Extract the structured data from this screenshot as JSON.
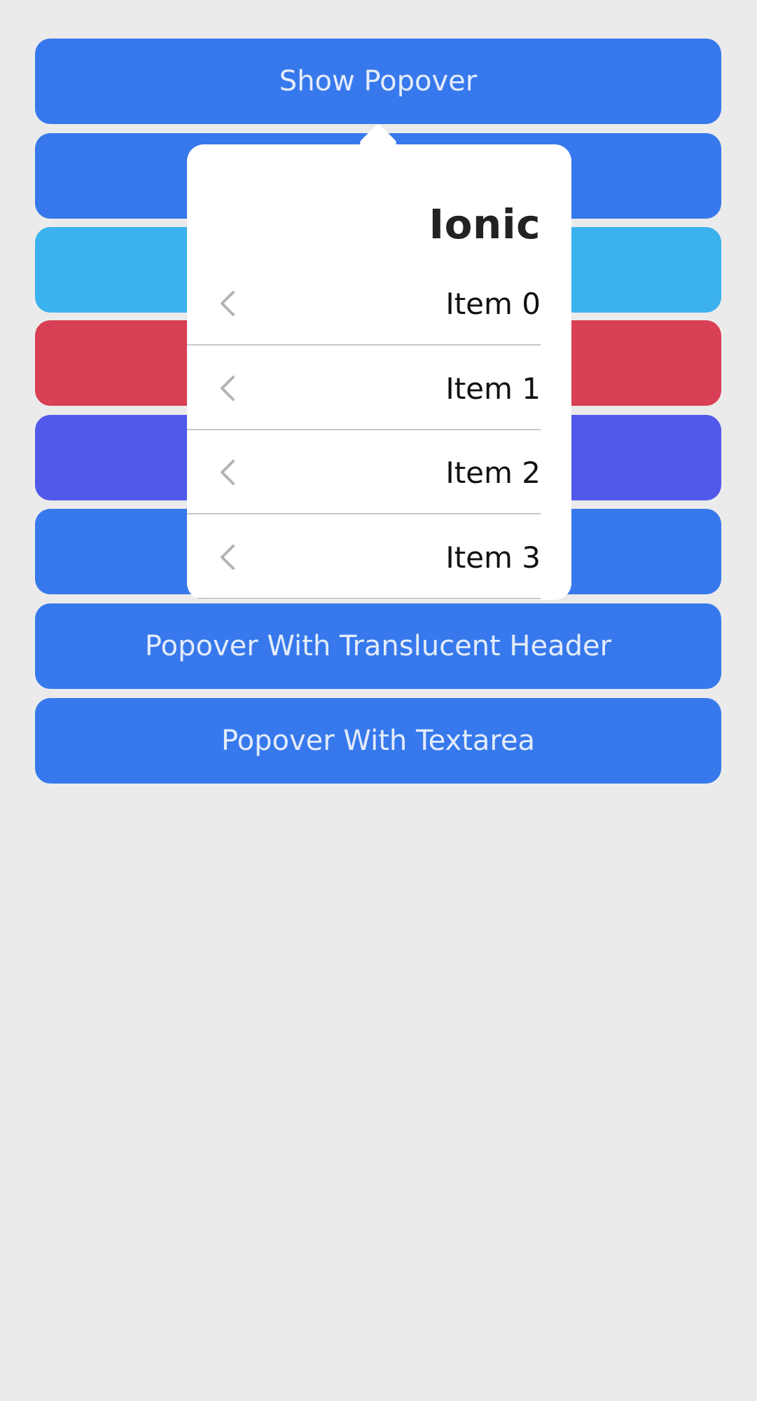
{
  "colors": {
    "background": "#ebebeb",
    "primary": "#3779ec",
    "secondary": "#3bb2ee",
    "danger": "#d93f55",
    "tertiary": "#5059ea",
    "popover_bg": "#ffffff",
    "button_text": "#e4ecfb"
  },
  "buttons": [
    {
      "label": "Show Popover",
      "color": "#3779ec"
    },
    {
      "label": "",
      "color": "#3779ec"
    },
    {
      "label": "",
      "color": "#3bb2ee"
    },
    {
      "label": "",
      "color": "#d93f55"
    },
    {
      "label": "",
      "color": "#5059ea"
    },
    {
      "label": "",
      "color": "#3779ec"
    },
    {
      "label": "Popover With Translucent Header",
      "color": "#3779ec"
    },
    {
      "label": "Popover With Textarea",
      "color": "#3779ec"
    }
  ],
  "popover": {
    "title": "Ionic",
    "items": [
      {
        "label": "Item 0",
        "icon": "chevron-left-icon"
      },
      {
        "label": "Item 1",
        "icon": "chevron-left-icon"
      },
      {
        "label": "Item 2",
        "icon": "chevron-left-icon"
      },
      {
        "label": "Item 3",
        "icon": "chevron-left-icon"
      }
    ]
  }
}
